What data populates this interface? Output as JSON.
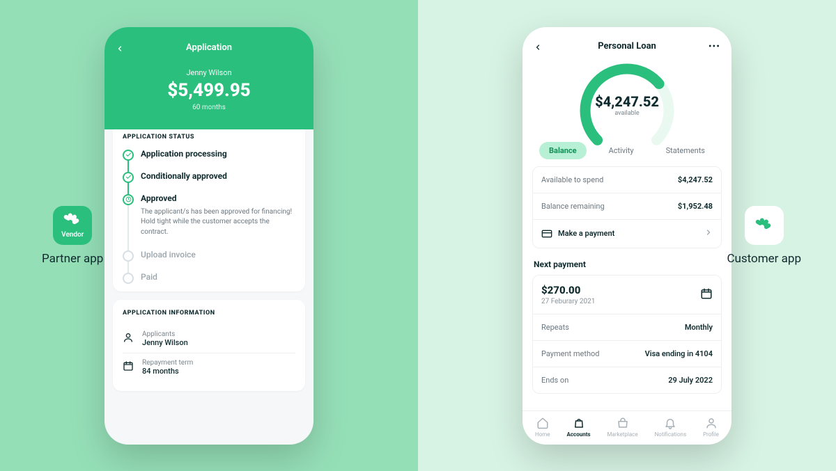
{
  "left": {
    "caption": "Partner app",
    "vendor_badge": "Vendor"
  },
  "right": {
    "caption": "Customer app"
  },
  "partner": {
    "title": "Application",
    "name": "Jenny Wilson",
    "amount": "$5,499.95",
    "term": "60 months",
    "status_heading": "APPLICATION STATUS",
    "steps": {
      "processing": "Application processing",
      "conditional": "Conditionally approved",
      "approved": "Approved",
      "approved_desc": "The applicant/s has been approved for financing! Hold tight while the customer accepts the contract.",
      "upload": "Upload invoice",
      "paid": "Paid"
    },
    "info_heading": "APPLICATION INFORMATION",
    "info": {
      "applicants_k": "Applicants",
      "applicants_v": "Jenny Wilson",
      "term_k": "Repayment term",
      "term_v": "84 months"
    }
  },
  "customer": {
    "title": "Personal Loan",
    "gauge_amount": "$4,247.52",
    "gauge_sub": "available",
    "tabs": {
      "balance": "Balance",
      "activity": "Activity",
      "statements": "Statements"
    },
    "balance": {
      "avail_k": "Available to spend",
      "avail_v": "$4,247.52",
      "remain_k": "Balance remaining",
      "remain_v": "$1,952.48",
      "make_payment": "Make a payment"
    },
    "next_heading": "Next payment",
    "next": {
      "amount": "$270.00",
      "date": "27 Feburary 2021",
      "repeats_k": "Repeats",
      "repeats_v": "Monthly",
      "method_k": "Payment method",
      "method_v": "Visa ending in 4104",
      "ends_k": "Ends on",
      "ends_v": "29 July 2022"
    },
    "nav": {
      "home": "Home",
      "accounts": "Accounts",
      "marketplace": "Marketplace",
      "notifications": "Notifications",
      "profile": "Profile"
    }
  }
}
